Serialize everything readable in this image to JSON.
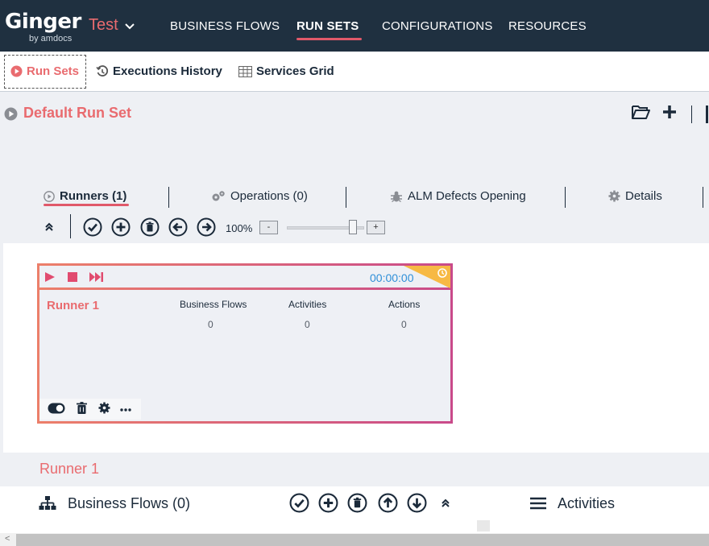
{
  "app": {
    "logo_text": "Ginger",
    "logo_sub": "by amdocs",
    "solution_name": "Test"
  },
  "nav": {
    "items": [
      {
        "label": "BUSINESS FLOWS"
      },
      {
        "label": "RUN SETS"
      },
      {
        "label": "CONFIGURATIONS"
      },
      {
        "label": "RESOURCES"
      }
    ],
    "active": "RUN SETS"
  },
  "subtabs": {
    "items": [
      {
        "label": "Run Sets",
        "icon": "play-circle-icon"
      },
      {
        "label": "Executions History",
        "icon": "history-icon"
      },
      {
        "label": "Services Grid",
        "icon": "grid-icon"
      }
    ],
    "active": "Run Sets"
  },
  "runset": {
    "title": "Default Run Set",
    "tabs": [
      {
        "label": "Runners (1)",
        "icon": "play-circle-icon"
      },
      {
        "label": "Operations (0)",
        "icon": "gears-icon"
      },
      {
        "label": "ALM Defects Opening",
        "icon": "bug-icon"
      },
      {
        "label": "Details",
        "icon": "gear-icon"
      }
    ],
    "zoom_level": "100%",
    "zoom_minus": "-",
    "zoom_plus": "+",
    "zoom_slider_fraction": 0.9
  },
  "runner_card": {
    "name": "Runner 1",
    "elapsed": "00:00:00",
    "stats": [
      {
        "label": "Business Flows",
        "value": "0"
      },
      {
        "label": "Activities",
        "value": "0"
      },
      {
        "label": "Actions",
        "value": "0"
      }
    ]
  },
  "runner_section": {
    "title": "Runner 1",
    "business_flows_label": "Business Flows (0)",
    "activities_label": "Activities"
  },
  "colors": {
    "accent": "#e96b6f",
    "topbar": "#1f3040",
    "timer": "#2f8fd8",
    "card_gradient_start": "#ec7f6a",
    "card_gradient_end": "#c94a8a"
  }
}
